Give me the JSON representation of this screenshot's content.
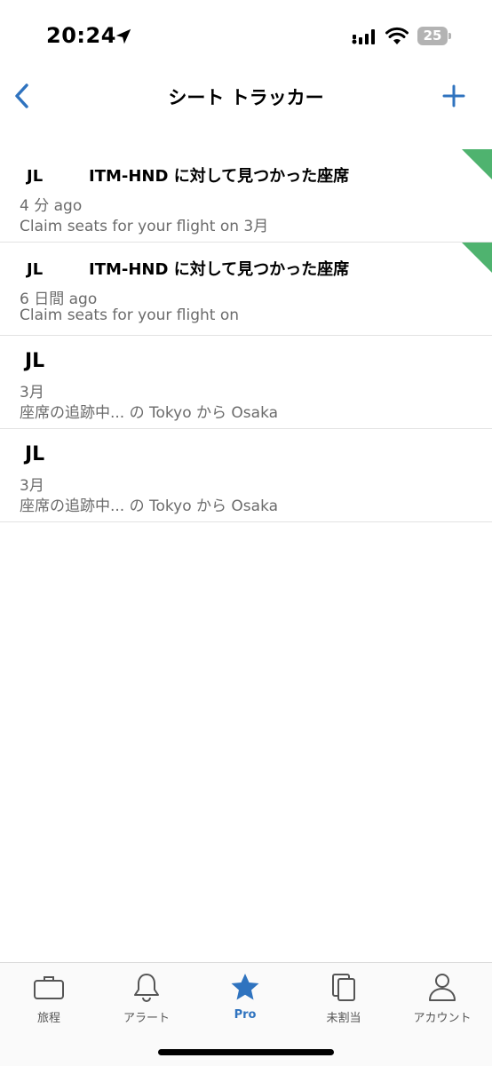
{
  "status_bar": {
    "time": "20:24",
    "battery_level": "25",
    "icons": [
      "location-arrow-icon",
      "cellular-signal-icon",
      "wifi-icon",
      "battery-icon"
    ]
  },
  "nav": {
    "title": "シート トラッカー",
    "back_icon": "chevron-left-icon",
    "add_icon": "plus-icon"
  },
  "colors": {
    "accent": "#2f73bf",
    "new_flag": "#4fb36f",
    "secondary_text": "#6b6b6b",
    "divider": "#e2e2e2"
  },
  "list": {
    "items": [
      {
        "airline": "JL",
        "route_text": "ITM-HND に対して見つかった座席",
        "line2": "4 分 ago",
        "line3": "Claim seats for your flight on 3月",
        "is_new": true
      },
      {
        "airline": "JL",
        "route_text": "ITM-HND に対して見つかった座席",
        "line2": "6 日間 ago",
        "line3": "Claim seats for your flight on",
        "is_new": true
      },
      {
        "airline": "JL",
        "line2": "3月",
        "line3": "座席の追跡中... の Tokyo から Osaka",
        "is_new": false
      },
      {
        "airline": "JL",
        "line2": "3月",
        "line3": "座席の追跡中... の Tokyo から Osaka",
        "is_new": false
      }
    ]
  },
  "tab_bar": {
    "tabs": [
      {
        "label": "旅程",
        "icon": "briefcase-icon",
        "active": false
      },
      {
        "label": "アラート",
        "icon": "bell-icon",
        "active": false
      },
      {
        "label": "Pro",
        "icon": "star-icon",
        "active": true
      },
      {
        "label": "未割当",
        "icon": "documents-icon",
        "active": false
      },
      {
        "label": "アカウント",
        "icon": "person-icon",
        "active": false
      }
    ]
  }
}
